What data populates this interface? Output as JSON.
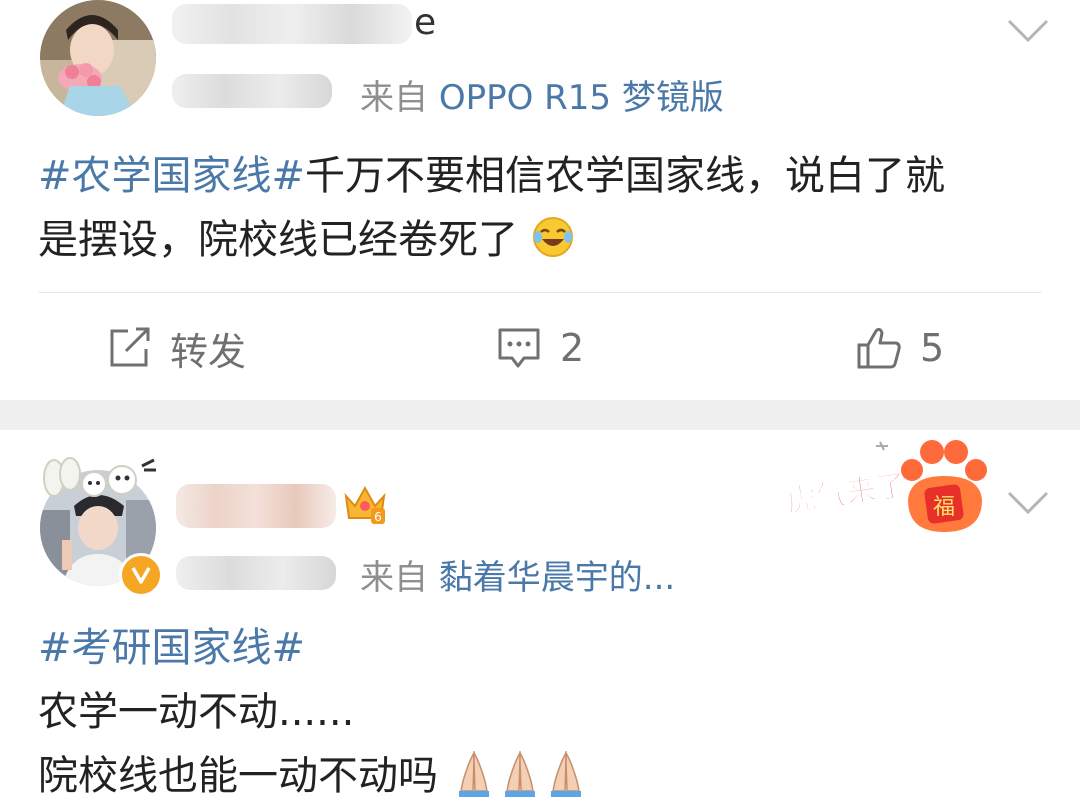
{
  "post1": {
    "meta_date_blurred": "22-3-11",
    "meta_from": "来自",
    "meta_source": "OPPO R15 梦镜版",
    "body": {
      "tag": "#农学国家线#",
      "line1_rest": "千万不要相信农学国家线，说白了就",
      "line2": "是摆设，院校线已经卷死了"
    },
    "actions": {
      "repost_label": "转发",
      "comment_count": "2",
      "like_count": "5"
    }
  },
  "post2": {
    "meta_date_blurred": "22-3-11",
    "meta_from": "来自",
    "meta_source": "黏着华晨宇的...",
    "crown_level": "6",
    "sticker_text": "虎气来了",
    "sticker_char": "福",
    "body": {
      "tag": "#考研国家线#",
      "line2": "农学一动不动......",
      "line3": "院校线也能一动不动吗"
    }
  },
  "icons": {
    "expand": "chevron-down-icon",
    "repost": "share-icon",
    "comment": "comment-icon",
    "like": "thumbs-up-icon",
    "verified": "verified-badge-icon",
    "emoji1": "laugh-cry-emoji",
    "emoji2": "praying-hands-emoji"
  },
  "colors": {
    "link": "#4a78a8",
    "meta": "#8f8f8f",
    "separator": "#f0f0f0",
    "verified": "#f5a623"
  }
}
